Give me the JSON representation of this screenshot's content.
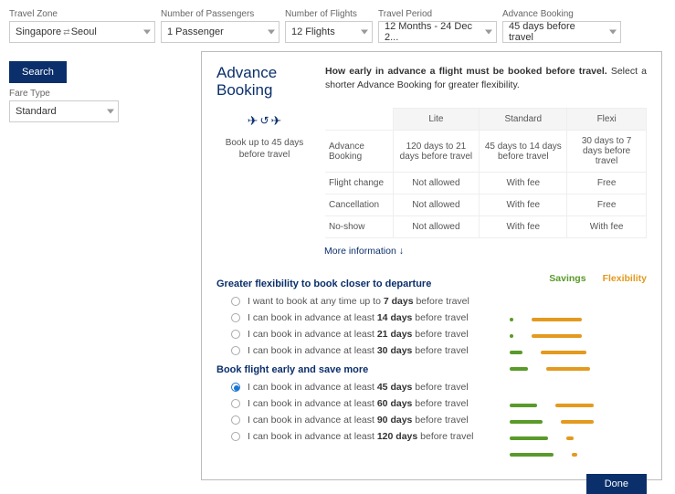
{
  "filters": {
    "zone": {
      "label": "Travel Zone",
      "value_from": "Singapore",
      "value_to": "Seoul"
    },
    "passengers": {
      "label": "Number of Passengers",
      "value": "1 Passenger"
    },
    "flights": {
      "label": "Number of Flights",
      "value": "12 Flights"
    },
    "period": {
      "label": "Travel Period",
      "value": "12 Months - 24 Dec 2..."
    },
    "advance": {
      "label": "Advance Booking",
      "value": "45 days before travel"
    },
    "fare": {
      "label": "Fare Type",
      "value": "Standard"
    },
    "search": "Search"
  },
  "panel": {
    "title": "Advance Booking",
    "subtitle_bold": "How early in advance a flight must be booked before travel.",
    "subtitle_rest": " Select a shorter Advance Booking for greater flexibility.",
    "illust_text": "Book up to 45 days before travel",
    "more_link": "More information ↓",
    "done": "Done"
  },
  "table": {
    "cols": [
      "Lite",
      "Standard",
      "Flexi"
    ],
    "rows": [
      {
        "h": "Advance Booking",
        "c": [
          "120 days to 21 days before travel",
          "45 days to 14 days before travel",
          "30 days to 7 days before travel"
        ]
      },
      {
        "h": "Flight change",
        "c": [
          "Not allowed",
          "With fee",
          "Free"
        ]
      },
      {
        "h": "Cancellation",
        "c": [
          "Not allowed",
          "With fee",
          "Free"
        ]
      },
      {
        "h": "No-show",
        "c": [
          "Not allowed",
          "With fee",
          "With fee"
        ]
      }
    ]
  },
  "opts": {
    "labels": {
      "savings": "Savings",
      "flex": "Flexibility"
    },
    "group_flex_title": "Greater flexibility to book closer to departure",
    "group_save_title": "Book flight early and save more",
    "rows": [
      {
        "sel": false,
        "pre": "I want to book at any time up to ",
        "days": "7 days",
        "post": " before travel",
        "s": 4,
        "f": 55
      },
      {
        "sel": false,
        "pre": "I can book in advance at least ",
        "days": "14 days",
        "post": " before travel",
        "s": 4,
        "f": 55
      },
      {
        "sel": false,
        "pre": "I can book in advance at least ",
        "days": "21 days",
        "post": " before travel",
        "s": 14,
        "f": 50
      },
      {
        "sel": false,
        "pre": "I can book in advance at least ",
        "days": "30 days",
        "post": " before travel",
        "s": 20,
        "f": 48
      },
      {
        "sel": true,
        "pre": "I can book in advance at least ",
        "days": "45 days",
        "post": " before travel",
        "s": 30,
        "f": 42
      },
      {
        "sel": false,
        "pre": "I can book in advance at least ",
        "days": "60 days",
        "post": " before travel",
        "s": 36,
        "f": 36
      },
      {
        "sel": false,
        "pre": "I can book in advance at least ",
        "days": "90 days",
        "post": " before travel",
        "s": 42,
        "f": 8
      },
      {
        "sel": false,
        "pre": "I can book in advance at least ",
        "days": "120 days",
        "post": " before travel",
        "s": 48,
        "f": 6
      }
    ]
  }
}
